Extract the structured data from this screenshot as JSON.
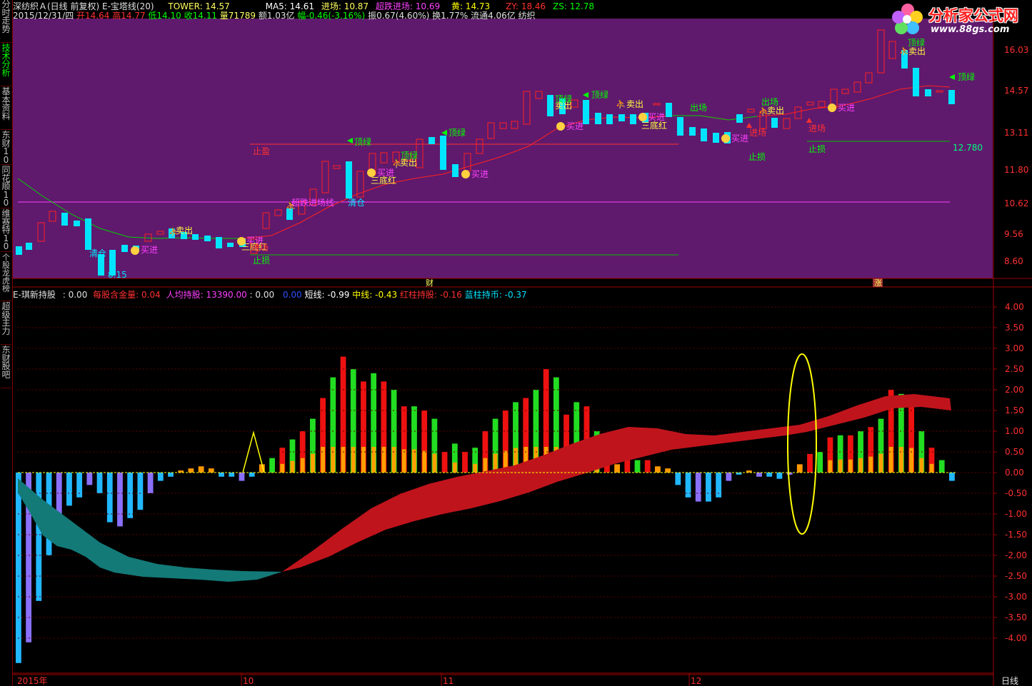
{
  "sidebar_tabs": [
    {
      "label": "分时走势",
      "active": false
    },
    {
      "label": "技术分析",
      "active": true
    },
    {
      "label": "基本资料",
      "active": false
    },
    {
      "label": "东财10",
      "active": false
    },
    {
      "label": "同花顺10",
      "active": false
    },
    {
      "label": "维赛特10",
      "active": false
    },
    {
      "label": "个股龙虎榜",
      "active": false
    },
    {
      "label": "超级主力",
      "active": false
    },
    {
      "label": "东财股吧",
      "active": false
    }
  ],
  "header": {
    "title": "深纺织Ａ(日线 前复权) E-宝塔线(20)",
    "tower": "TOWER: 14.57",
    "ma5": "MA5: 14.61",
    "entry": "进场: 10.87",
    "oversold_entry": "超跌进场: 10.69",
    "yellow": "黄: 14.73",
    "zy": "ZY: 18.46",
    "zs": "ZS: 12.78",
    "date": "2015/12/31/四",
    "open": "开14.64",
    "high": "高14.77",
    "low": "低14.10",
    "close": "收14.11",
    "volume": "量71789",
    "amount": "额1.03亿",
    "change": "幅-0.46(-3.16%)",
    "amplitude": "振0.67(4.60%)",
    "turnover": "换1.77%",
    "float_cap": "流通4.06亿",
    "stock_short": "纺织"
  },
  "logo": {
    "text": "分析家公式网",
    "url_text": "www.88gs.com"
  },
  "upper_axis": [
    "16.03",
    "14.57",
    "13.11",
    "11.80",
    "10.62",
    "9.56",
    "8.60"
  ],
  "lower_axis": [
    "4.00",
    "3.50",
    "3.00",
    "2.50",
    "2.00",
    "1.50",
    "1.00",
    "0.50",
    "0.00",
    "-0.50",
    "-1.00",
    "-1.50",
    "-2.00",
    "-2.50",
    "-3.00",
    "-3.50",
    "-4.00"
  ],
  "upper_price_labels": {
    "zy_line": "12.780"
  },
  "indicator": {
    "name": "E-琪新持股",
    "v0": ": 0.00",
    "shares_label": "每股含金量",
    "shares_val": ": 0.04",
    "avg_label": "人均持股",
    "avg_val": ": 13390.00",
    "v3": ": 0.00",
    "v4": "0.00",
    "short_label": "短线",
    "short_val": ": -0.99",
    "mid_label": "中线",
    "mid_val": ": -0.43",
    "red_label": "红柱持股",
    "red_val": ": -0.16",
    "blue_label": "蓝柱持币",
    "blue_val": ": -0.37"
  },
  "annotations": {
    "buy": "买进",
    "sell": "卖出",
    "top_green": "顶绿",
    "bottom_red": "三底红",
    "clear": "清仓",
    "take_profit": "止盈",
    "stop_loss": "止损",
    "enter": "进场",
    "exit": "出场",
    "oversold": "超跌进场线",
    "low_price": "8.15"
  },
  "markers": {
    "cai": "财",
    "zhang": "涨"
  },
  "x_axis": {
    "labels": [
      "2015年",
      "10",
      "11",
      "12"
    ],
    "period": "日线"
  },
  "colors": {
    "upper_bg": "#5f1a6d",
    "up": "#ff2020",
    "down": "#00e5ff",
    "green": "#00ff00",
    "yellow": "#ffff00",
    "magenta": "#ff40ff",
    "band_red": "#c0141c",
    "band_teal": "#137a78"
  },
  "chart_data": {
    "type": "bar",
    "title": "E-琪新持股",
    "ylim": [
      -4.5,
      4.3
    ],
    "values": [
      -4.6,
      -4.1,
      -3.1,
      -2.0,
      -1.4,
      -0.8,
      -0.6,
      -0.3,
      -0.5,
      -1.2,
      -1.3,
      -1.1,
      -0.9,
      -0.5,
      -0.2,
      -0.1,
      0.05,
      0.1,
      0.15,
      0.1,
      -0.1,
      -0.1,
      -0.2,
      -0.1,
      0.2,
      0.35,
      0.6,
      0.8,
      1.0,
      1.3,
      1.8,
      2.3,
      2.8,
      2.5,
      2.2,
      2.4,
      2.2,
      2.0,
      1.6,
      1.6,
      1.5,
      1.3,
      0.5,
      0.7,
      0.5,
      0.6,
      1.0,
      1.3,
      1.5,
      1.7,
      1.8,
      2.0,
      2.5,
      2.3,
      1.4,
      1.7,
      1.6,
      1.0,
      0.3,
      0.2,
      0.3,
      0.3,
      0.3,
      0.15,
      0.1,
      -0.3,
      -0.6,
      -0.7,
      -0.7,
      -0.6,
      -0.2,
      -0.05,
      0.05,
      -0.1,
      -0.1,
      -0.15,
      -0.05,
      0.2,
      0.45,
      0.5,
      0.85,
      0.9,
      0.9,
      1.0,
      1.1,
      1.3,
      2.0,
      1.9,
      1.7,
      1.0,
      0.6,
      0.3,
      -0.2
    ]
  }
}
